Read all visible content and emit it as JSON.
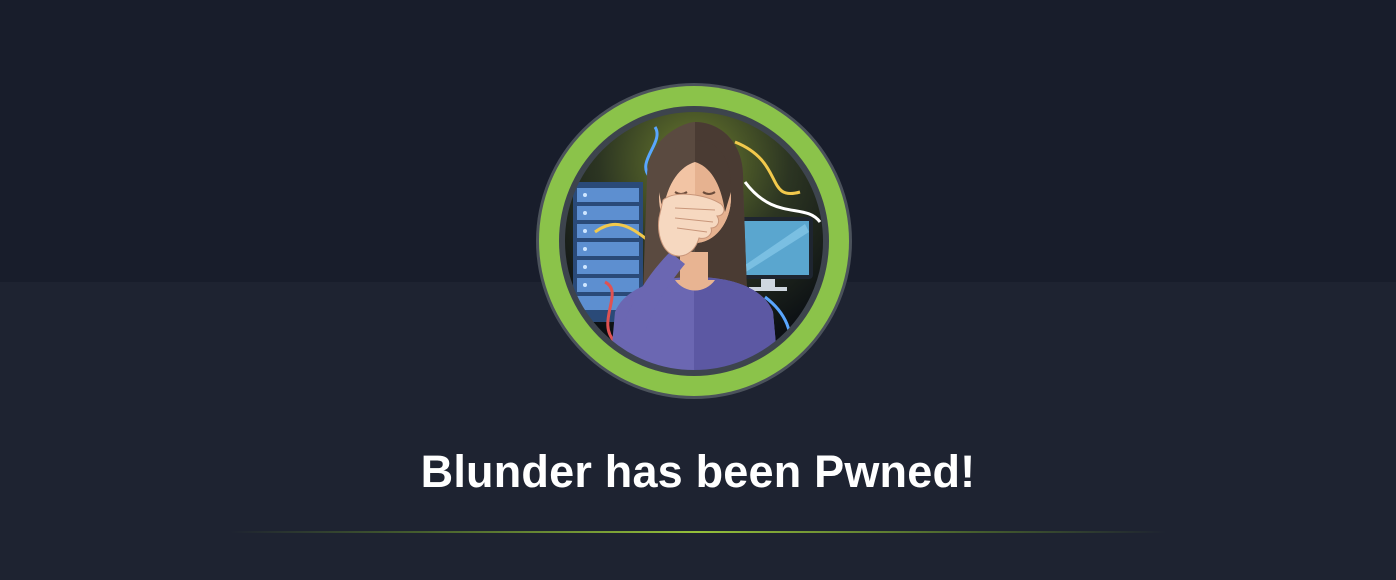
{
  "banner": {
    "title": "Blunder has been Pwned!",
    "machine_name": "Blunder",
    "avatar_icon": "facepalm-avatar-icon"
  },
  "colors": {
    "top_background": "#181d2b",
    "bottom_background": "#1e2331",
    "ring_green": "#8bc34a",
    "title_text": "#ffffff",
    "divider_accent": "#9fef00"
  }
}
